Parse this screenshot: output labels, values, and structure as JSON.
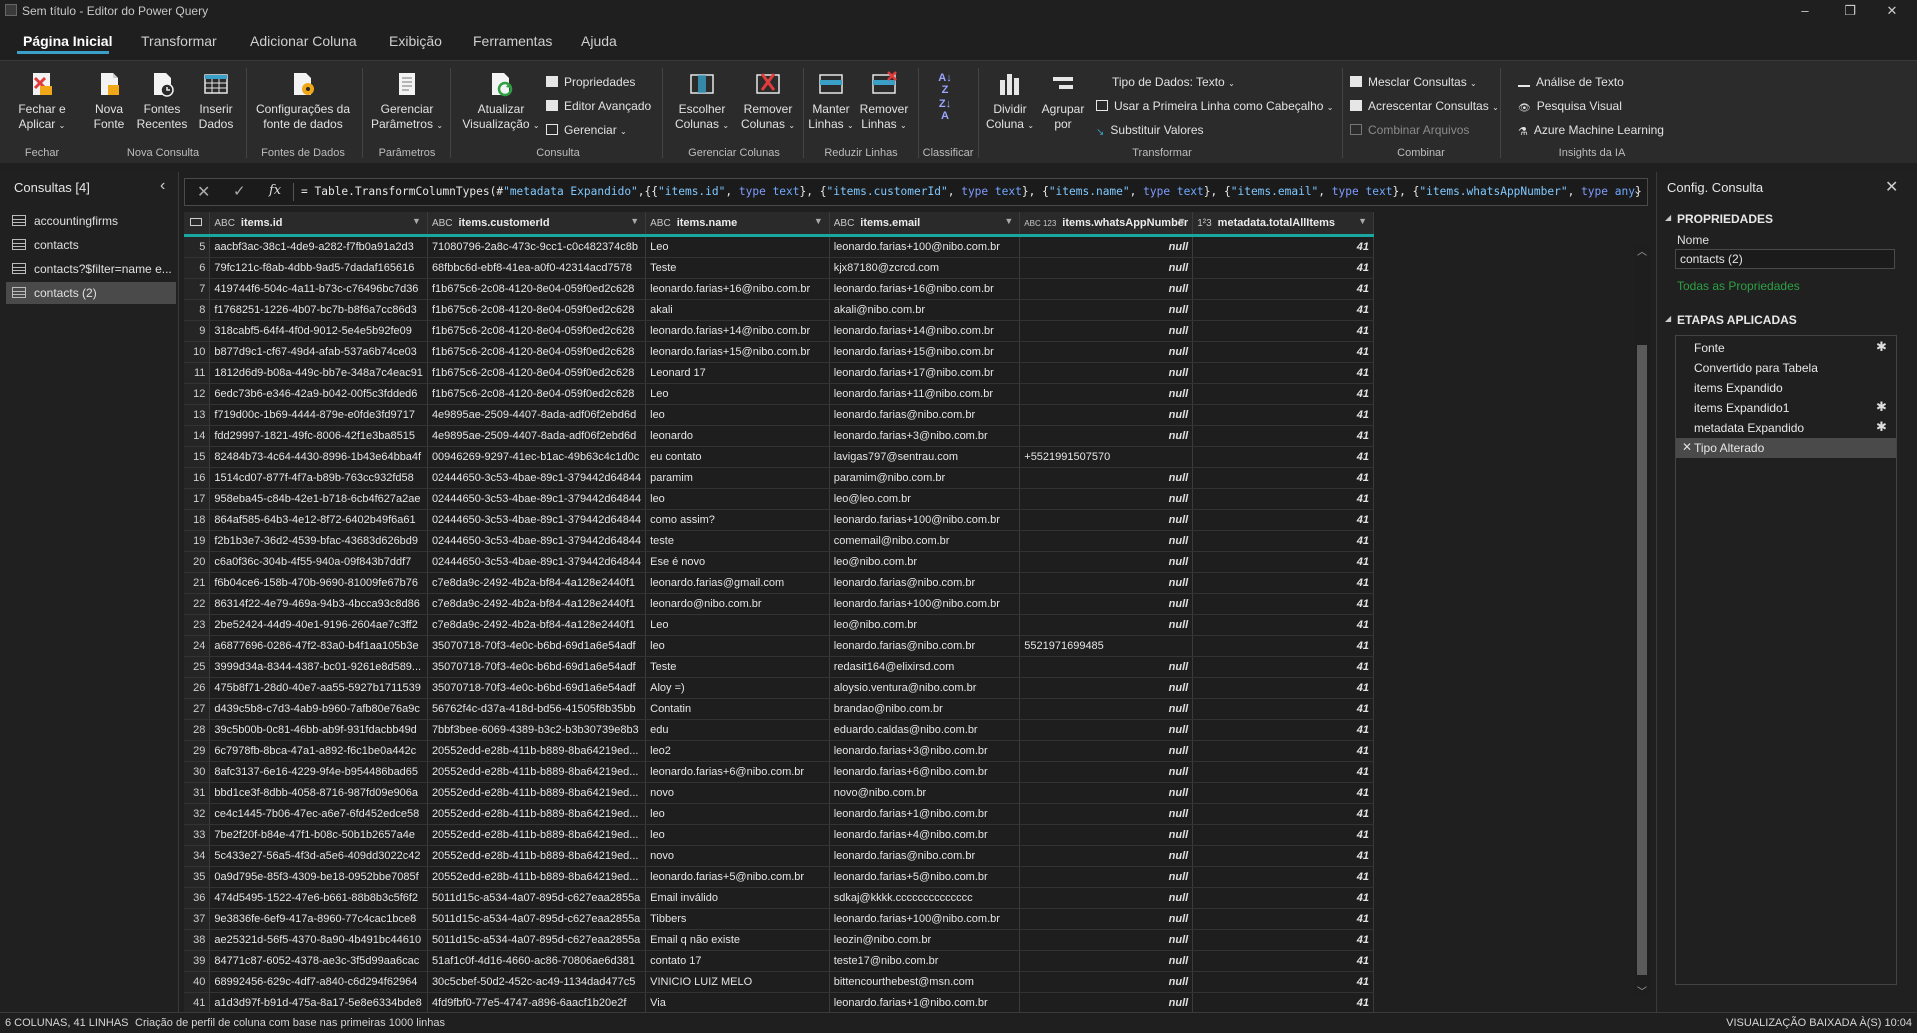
{
  "window": {
    "title": "Sem título - Editor do Power Query",
    "minimize": "–",
    "restore": "❐",
    "close": "✕"
  },
  "tabs": [
    {
      "label": "Página Inicial",
      "active": true
    },
    {
      "label": "Transformar"
    },
    {
      "label": "Adicionar Coluna"
    },
    {
      "label": "Exibição"
    },
    {
      "label": "Ferramentas"
    },
    {
      "label": "Ajuda"
    }
  ],
  "ribbon": {
    "close_apply": "Fechar e Aplicar",
    "new_source": "Nova Fonte",
    "recent_sources": "Fontes Recentes",
    "enter_data": "Inserir Dados",
    "source_settings": "Configurações da fonte de dados",
    "manage_params": "Gerenciar Parâmetros",
    "refresh_preview": "Atualizar Visualização",
    "properties": "Propriedades",
    "advanced_editor": "Editor Avançado",
    "manage": "Gerenciar",
    "choose_columns": "Escolher Colunas",
    "remove_columns": "Remover Colunas",
    "keep_rows": "Manter Linhas",
    "remove_rows": "Remover Linhas",
    "split_column": "Dividir Coluna",
    "group_by": "Agrupar por",
    "data_type": "Tipo de Dados: Texto",
    "first_row_header": "Usar a Primeira Linha como Cabeçalho",
    "replace_values": "Substituir Valores",
    "merge_queries": "Mesclar Consultas",
    "append_queries": "Acrescentar Consultas",
    "combine_files": "Combinar Arquivos",
    "text_analytics": "Análise de Texto",
    "vision": "Pesquisa Visual",
    "azure_ml": "Azure Machine Learning",
    "groups": {
      "close": "Fechar",
      "new_query": "Nova Consulta",
      "data_sources": "Fontes de Dados",
      "parameters": "Parâmetros",
      "query": "Consulta",
      "manage_columns": "Gerenciar Colunas",
      "reduce_rows": "Reduzir Linhas",
      "sort": "Classificar",
      "transform": "Transformar",
      "combine": "Combinar",
      "ai_insights": "Insights da IA"
    }
  },
  "queries_pane": {
    "title": "Consultas [4]",
    "items": [
      "accountingfirms",
      "contacts",
      "contacts?$filter=name e...",
      "contacts (2)"
    ]
  },
  "formula_bar": {
    "fx": "fx",
    "formula": "= Table.TransformColumnTypes(#\"metadata Expandido\",{{\"items.id\", type text}, {\"items.customerId\", type text}, {\"items.name\", type text}, {\"items.email\", type text}, {\"items.whatsAppNumber\", type any}"
  },
  "grid": {
    "columns": [
      {
        "type": "ABC",
        "name": "items.id"
      },
      {
        "type": "ABC",
        "name": "items.customerId"
      },
      {
        "type": "ABC",
        "name": "items.name"
      },
      {
        "type": "ABC",
        "name": "items.email"
      },
      {
        "type": "ABC 123",
        "name": "items.whatsAppNumber"
      },
      {
        "type": "1²3",
        "name": "metadata.totalAllItems"
      }
    ],
    "rows": [
      [
        "5",
        "aacbf3ac-38c1-4de9-a282-f7fb0a91a2d3",
        "71080796-2a8c-473c-9cc1-c0c482374c8b",
        "Leo",
        "leonardo.farias+100@nibo.com.br",
        "null",
        "41"
      ],
      [
        "6",
        "79fc121c-f8ab-4dbb-9ad5-7dadaf165616",
        "68fbbc6d-ebf8-41ea-a0f0-42314acd7578",
        "Teste",
        "kjx87180@zcrcd.com",
        "null",
        "41"
      ],
      [
        "7",
        "419744f6-504c-4a11-b73c-c76496bc7d36",
        "f1b675c6-2c08-4120-8e04-059f0ed2c628",
        "leonardo.farias+16@nibo.com.br",
        "leonardo.farias+16@nibo.com.br",
        "null",
        "41"
      ],
      [
        "8",
        "f1768251-1226-4b07-bc7b-b8f6a7cc86d3",
        "f1b675c6-2c08-4120-8e04-059f0ed2c628",
        "akali",
        "akali@nibo.com.br",
        "null",
        "41"
      ],
      [
        "9",
        "318cabf5-64f4-4f0d-9012-5e4e5b92fe09",
        "f1b675c6-2c08-4120-8e04-059f0ed2c628",
        "leonardo.farias+14@nibo.com.br",
        "leonardo.farias+14@nibo.com.br",
        "null",
        "41"
      ],
      [
        "10",
        "b877d9c1-cf67-49d4-afab-537a6b74ce03",
        "f1b675c6-2c08-4120-8e04-059f0ed2c628",
        "leonardo.farias+15@nibo.com.br",
        "leonardo.farias+15@nibo.com.br",
        "null",
        "41"
      ],
      [
        "11",
        "1812d6d9-b08a-449c-bb7e-348a7c4eac91",
        "f1b675c6-2c08-4120-8e04-059f0ed2c628",
        "Leonard 17",
        "leonardo.farias+17@nibo.com.br",
        "null",
        "41"
      ],
      [
        "12",
        "6edc73b6-e346-42a9-b042-00f5c3fdded6",
        "f1b675c6-2c08-4120-8e04-059f0ed2c628",
        "Leo",
        "leonardo.farias+11@nibo.com.br",
        "null",
        "41"
      ],
      [
        "13",
        "f719d00c-1b69-4444-879e-e0fde3fd9717",
        "4e9895ae-2509-4407-8ada-adf06f2ebd6d",
        "leo",
        "leonardo.farias@nibo.com.br",
        "null",
        "41"
      ],
      [
        "14",
        "fdd29997-1821-49fc-8006-42f1e3ba8515",
        "4e9895ae-2509-4407-8ada-adf06f2ebd6d",
        "leonardo",
        "leonardo.farias+3@nibo.com.br",
        "null",
        "41"
      ],
      [
        "15",
        "82484b73-4c64-4430-8996-1b43e64bba4f",
        "00946269-9297-41ec-b1ac-49b63c4c1d0c",
        "eu contato",
        "lavigas797@sentrau.com",
        "+5521991507570",
        "41"
      ],
      [
        "16",
        "1514cd07-877f-4f7a-b89b-763cc932fd58",
        "02444650-3c53-4bae-89c1-379442d64844",
        "paramim",
        "paramim@nibo.com.br",
        "null",
        "41"
      ],
      [
        "17",
        "958eba45-c84b-42e1-b718-6cb4f627a2ae",
        "02444650-3c53-4bae-89c1-379442d64844",
        "leo",
        "leo@leo.com.br",
        "null",
        "41"
      ],
      [
        "18",
        "864af585-64b3-4e12-8f72-6402b49f6a61",
        "02444650-3c53-4bae-89c1-379442d64844",
        "como assim?",
        "leonardo.farias+100@nibo.com.br",
        "null",
        "41"
      ],
      [
        "19",
        "f2b1b3e7-36d2-4539-bfac-43683d626bd9",
        "02444650-3c53-4bae-89c1-379442d64844",
        "teste",
        "comemail@nibo.com.br",
        "null",
        "41"
      ],
      [
        "20",
        "c6a0f36c-304b-4f55-940a-09f843b7ddf7",
        "02444650-3c53-4bae-89c1-379442d64844",
        "Ese é novo",
        "leo@nibo.com.br",
        "null",
        "41"
      ],
      [
        "21",
        "f6b04ce6-158b-470b-9690-81009fe67b76",
        "c7e8da9c-2492-4b2a-bf84-4a128e2440f1",
        "leonardo.farias@gmail.com",
        "leonardo.farias@nibo.com.br",
        "null",
        "41"
      ],
      [
        "22",
        "86314f22-4e79-469a-94b3-4bcca93c8d86",
        "c7e8da9c-2492-4b2a-bf84-4a128e2440f1",
        "leonardo@nibo.com.br",
        "leonardo.farias+100@nibo.com.br",
        "null",
        "41"
      ],
      [
        "23",
        "2be52424-44d9-40e1-9196-2604ae7c3ff2",
        "c7e8da9c-2492-4b2a-bf84-4a128e2440f1",
        "Leo",
        "leo@nibo.com.br",
        "null",
        "41"
      ],
      [
        "24",
        "a6877696-0286-47f2-83a0-b4f1aa105b3e",
        "35070718-70f3-4e0c-b6bd-69d1a6e54adf",
        "leo",
        "leonardo.farias@nibo.com.br",
        "5521971699485",
        "41"
      ],
      [
        "25",
        "3999d34a-8344-4387-bc01-9261e8d589...",
        "35070718-70f3-4e0c-b6bd-69d1a6e54adf",
        "Teste",
        "redasit164@elixirsd.com",
        "null",
        "41"
      ],
      [
        "26",
        "475b8f71-28d0-40e7-aa55-5927b1711539",
        "35070718-70f3-4e0c-b6bd-69d1a6e54adf",
        "Aloy =)",
        "aloysio.ventura@nibo.com.br",
        "null",
        "41"
      ],
      [
        "27",
        "d439c5b8-c7d3-4ab9-b960-7afb80e76a9c",
        "56762f4c-d37a-418d-bd56-41505f8b35bb",
        "Contatin",
        "brandao@nibo.com.br",
        "null",
        "41"
      ],
      [
        "28",
        "39c5b00b-0c81-46bb-ab9f-931fdacbb49d",
        "7bbf3bee-6069-4389-b3c2-b3b30739e8b3",
        "edu",
        "eduardo.caldas@nibo.com.br",
        "null",
        "41"
      ],
      [
        "29",
        "6c7978fb-8bca-47a1-a892-f6c1be0a442c",
        "20552edd-e28b-411b-b889-8ba64219ed...",
        "leo2",
        "leonardo.farias+3@nibo.com.br",
        "null",
        "41"
      ],
      [
        "30",
        "8afc3137-6e16-4229-9f4e-b954486bad65",
        "20552edd-e28b-411b-b889-8ba64219ed...",
        "leonardo.farias+6@nibo.com.br",
        "leonardo.farias+6@nibo.com.br",
        "null",
        "41"
      ],
      [
        "31",
        "bbd1ce3f-8dbb-4058-8716-987fd09e906a",
        "20552edd-e28b-411b-b889-8ba64219ed...",
        "novo",
        "novo@nibo.com.br",
        "null",
        "41"
      ],
      [
        "32",
        "ce4c1445-7b06-47ec-a6e7-6fd452edce58",
        "20552edd-e28b-411b-b889-8ba64219ed...",
        "leo",
        "leonardo.farias+1@nibo.com.br",
        "null",
        "41"
      ],
      [
        "33",
        "7be2f20f-b84e-47f1-b08c-50b1b2657a4e",
        "20552edd-e28b-411b-b889-8ba64219ed...",
        "leo",
        "leonardo.farias+4@nibo.com.br",
        "null",
        "41"
      ],
      [
        "34",
        "5c433e27-56a5-4f3d-a5e6-409dd3022c42",
        "20552edd-e28b-411b-b889-8ba64219ed...",
        "novo",
        "leonardo.farias@nibo.com.br",
        "null",
        "41"
      ],
      [
        "35",
        "0a9d795e-85f3-4309-be18-0952bbe7085f",
        "20552edd-e28b-411b-b889-8ba64219ed...",
        "leonardo.farias+5@nibo.com.br",
        "leonardo.farias+5@nibo.com.br",
        "null",
        "41"
      ],
      [
        "36",
        "474d5495-1522-47e6-b661-88b8b3c5f6f2",
        "5011d15c-a534-4a07-895d-c627eaa2855a",
        "Email inválido",
        "sdkaj@kkkk.cccccccccccccc",
        "null",
        "41"
      ],
      [
        "37",
        "9e3836fe-6ef9-417a-8960-77c4cac1bce8",
        "5011d15c-a534-4a07-895d-c627eaa2855a",
        "Tibbers",
        "leonardo.farias+100@nibo.com.br",
        "null",
        "41"
      ],
      [
        "38",
        "ae25321d-56f5-4370-8a90-4b491bc44610",
        "5011d15c-a534-4a07-895d-c627eaa2855a",
        "Email q não existe",
        "leozin@nibo.com.br",
        "null",
        "41"
      ],
      [
        "39",
        "84771c87-6052-4378-ae3c-3f5d99aa6cac",
        "51af1c0f-4d16-4660-ac86-70806ae6d381",
        "contato 17",
        "teste17@nibo.com.br",
        "null",
        "41"
      ],
      [
        "40",
        "68992456-629c-4df7-a840-c6d294f62964",
        "30c5cbef-50d2-452c-ac49-1134dad477c5",
        "VINICIO LUIZ MELO",
        "bittencourthebest@msn.com",
        "null",
        "41"
      ],
      [
        "41",
        "a1d3d97f-b91d-475a-8a17-5e8e6334bde8",
        "4fd9fbf0-77e5-4747-a896-6aacf1b20e2f",
        "Via",
        "leonardo.farias+1@nibo.com.br",
        "null",
        "41"
      ]
    ]
  },
  "query_settings": {
    "title": "Config. Consulta",
    "properties_header": "PROPRIEDADES",
    "name_label": "Nome",
    "name_value": "contacts (2)",
    "all_properties": "Todas as Propriedades",
    "steps_header": "ETAPAS APLICADAS",
    "steps": [
      {
        "label": "Fonte",
        "gear": true
      },
      {
        "label": "Convertido para Tabela",
        "gear": false
      },
      {
        "label": "items Expandido",
        "gear": false
      },
      {
        "label": "items Expandido1",
        "gear": true
      },
      {
        "label": "metadata Expandido",
        "gear": true
      },
      {
        "label": "Tipo Alterado",
        "gear": false,
        "selected": true
      }
    ]
  },
  "status_bar": {
    "left": "6 COLUNAS, 41 LINHAS",
    "profiling": "Criação de perfil de coluna com base nas primeiras 1000 linhas",
    "right": "VISUALIZAÇÃO BAIXADA À(S) 10:04"
  },
  "colors": {
    "accent": "#1aa7a0",
    "link": "#2ea043",
    "tab_underline": "#3aa0c8"
  }
}
